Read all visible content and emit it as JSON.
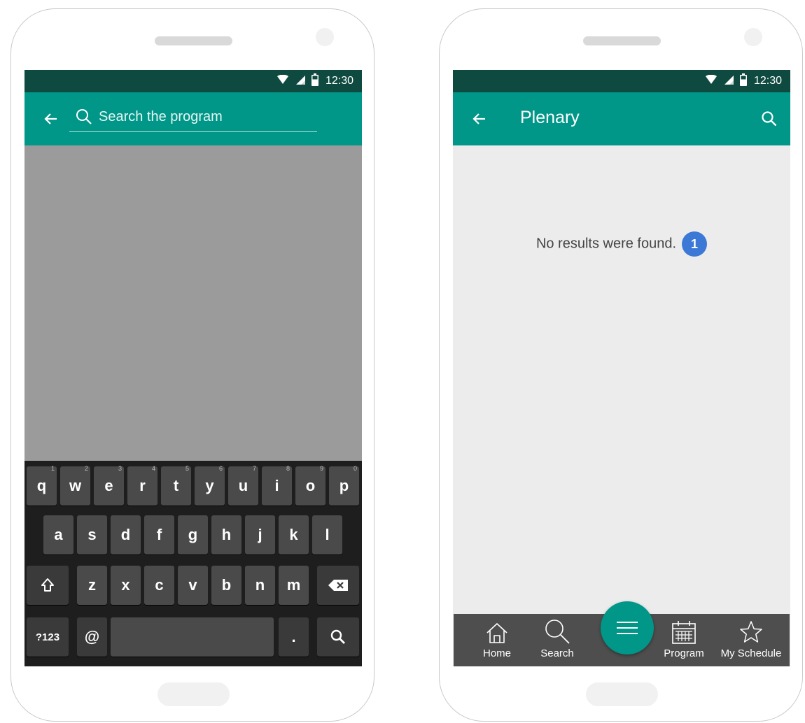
{
  "status_bar": {
    "time": "12:30"
  },
  "left_screen": {
    "search": {
      "placeholder": "Search the program"
    },
    "keyboard": {
      "row1": [
        {
          "key": "q",
          "hint": "1"
        },
        {
          "key": "w",
          "hint": "2"
        },
        {
          "key": "e",
          "hint": "3"
        },
        {
          "key": "r",
          "hint": "4"
        },
        {
          "key": "t",
          "hint": "5"
        },
        {
          "key": "y",
          "hint": "6"
        },
        {
          "key": "u",
          "hint": "7"
        },
        {
          "key": "i",
          "hint": "8"
        },
        {
          "key": "o",
          "hint": "9"
        },
        {
          "key": "p",
          "hint": "0"
        }
      ],
      "row2": [
        "a",
        "s",
        "d",
        "f",
        "g",
        "h",
        "j",
        "k",
        "l"
      ],
      "row3": [
        "z",
        "x",
        "c",
        "v",
        "b",
        "n",
        "m"
      ],
      "symbols_label": "?123",
      "at_label": "@",
      "period_label": "."
    }
  },
  "right_screen": {
    "title": "Plenary",
    "empty_message": "No results were found.",
    "badge_number": "1",
    "nav": {
      "home": "Home",
      "search": "Search",
      "program": "Program",
      "my_schedule": "My Schedule"
    }
  }
}
